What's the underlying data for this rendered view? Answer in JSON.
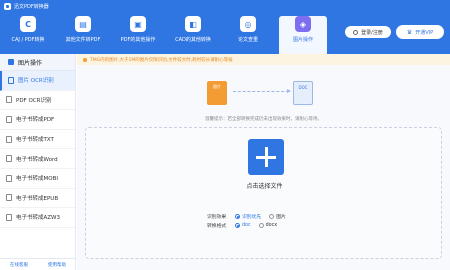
{
  "app": {
    "title": "迅文PDF转换器"
  },
  "toolbar": {
    "items": [
      {
        "label": "CAJ / PDF转换",
        "icon": "c-icon",
        "glyph": "C"
      },
      {
        "label": "其他文件转PDF",
        "icon": "convert-icon",
        "glyph": "▤"
      },
      {
        "label": "PDF的其他操作",
        "icon": "pdf-tools-icon",
        "glyph": "▣"
      },
      {
        "label": "CAD的其他转换",
        "icon": "cad-icon",
        "glyph": "◧"
      },
      {
        "label": "论文查重",
        "icon": "search-icon",
        "glyph": "◎"
      },
      {
        "label": "图片操作",
        "icon": "image-icon",
        "glyph": "◈"
      }
    ],
    "active_index": 5,
    "login_label": "登录/注册",
    "vip_label": "开通VIP"
  },
  "sidebar": {
    "header": "图片操作",
    "items": [
      {
        "label": "图片 OCR识别",
        "active": true
      },
      {
        "label": "PDF OCR识别"
      },
      {
        "label": "电子书转成PDF"
      },
      {
        "label": "电子书转成TXT"
      },
      {
        "label": "电子书转成Word"
      },
      {
        "label": "电子书转成MOBI"
      },
      {
        "label": "电子书转成EPUB"
      },
      {
        "label": "电子书转成AZW3"
      }
    ],
    "footer": {
      "left": "在线客服",
      "right": "使用帮助"
    }
  },
  "main": {
    "notice": "TMG内的图片,大于1M的图片仅限识别,文件较大时,耗时较长请耐心等候",
    "flow": {
      "from_label": "图片",
      "to_label": "DOC"
    },
    "hint": "温馨提示：若全部转换完成仍未出现效果时，请耐心等待。",
    "add_label": "点击选择文件",
    "options": {
      "recognize_label": "识别效果",
      "recognize_choices": [
        "识别优先",
        "图片"
      ],
      "recognize_selected": 0,
      "format_label": "转换格式",
      "format_choices": [
        "doc",
        "docx"
      ],
      "format_selected": 0
    }
  }
}
